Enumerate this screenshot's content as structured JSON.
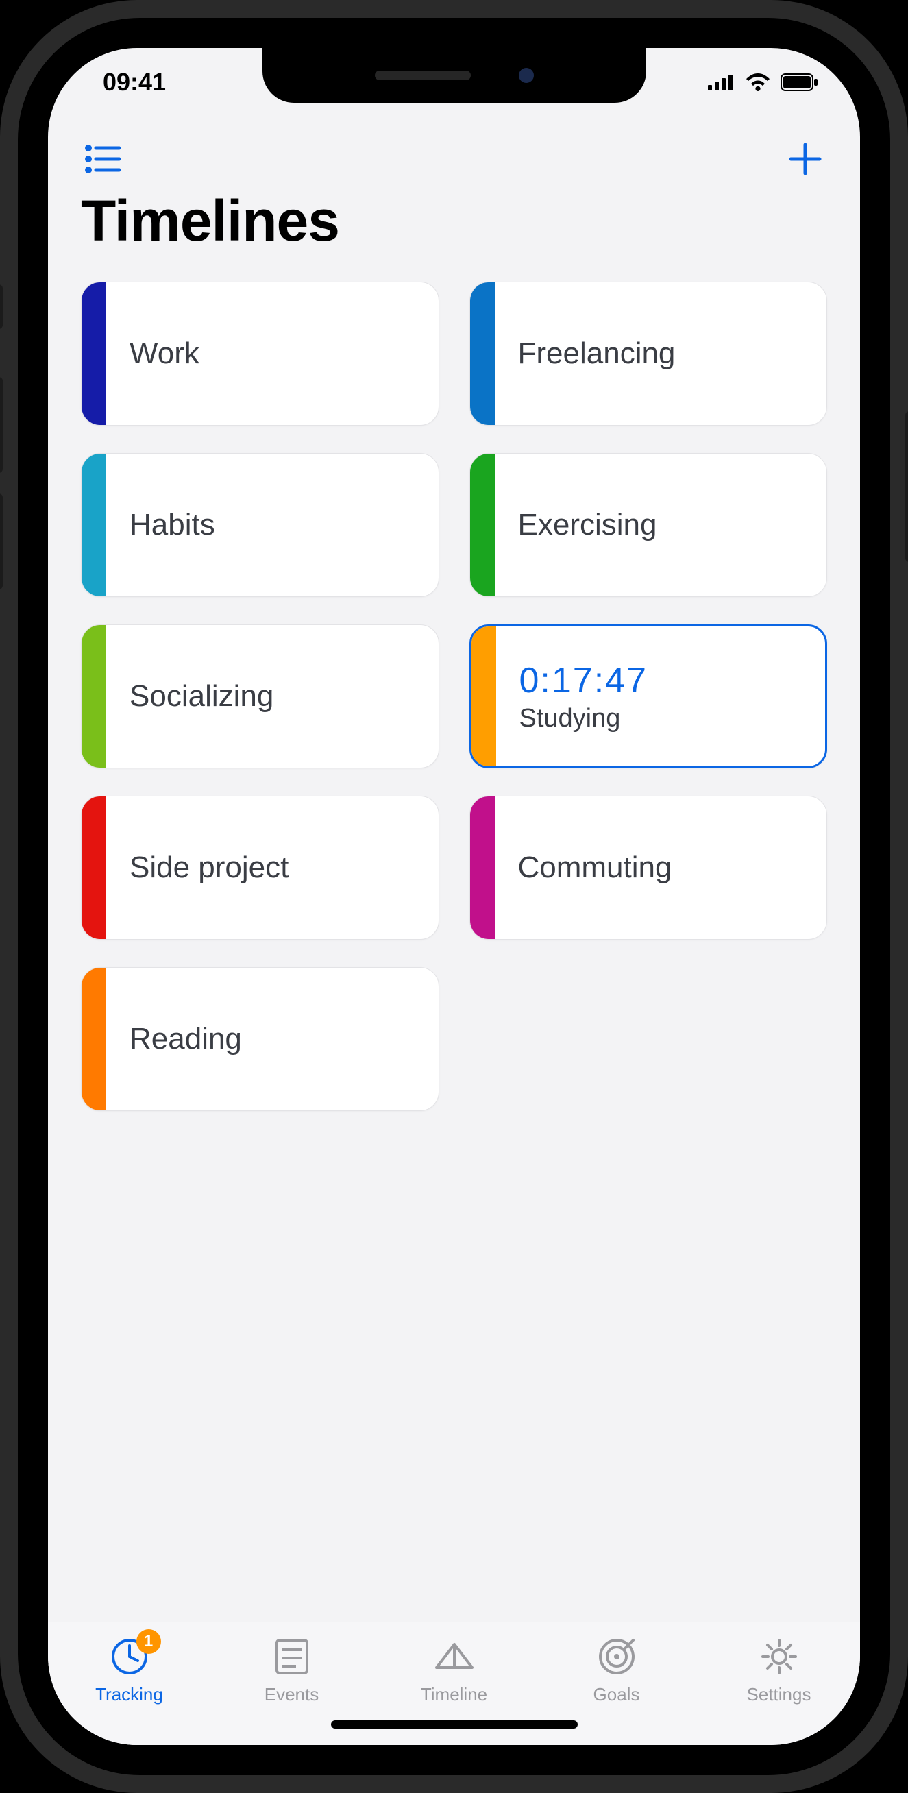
{
  "statusbar": {
    "time": "09:41"
  },
  "page_title": "Timelines",
  "accent_color": "#0b66e4",
  "cards": [
    {
      "label": "Work",
      "color": "#151ca8"
    },
    {
      "label": "Freelancing",
      "color": "#0a73c6"
    },
    {
      "label": "Habits",
      "color": "#19a3c8"
    },
    {
      "label": "Exercising",
      "color": "#1aa51f"
    },
    {
      "label": "Socializing",
      "color": "#7abf1a"
    },
    {
      "label": "Studying",
      "color": "#ff9e00",
      "active": true,
      "timer": "0:17:47"
    },
    {
      "label": "Side project",
      "color": "#e4140f"
    },
    {
      "label": "Commuting",
      "color": "#c1108b"
    },
    {
      "label": "Reading",
      "color": "#ff7a00"
    }
  ],
  "tabs": [
    {
      "label": "Tracking",
      "badge": "1",
      "active": true
    },
    {
      "label": "Events"
    },
    {
      "label": "Timeline"
    },
    {
      "label": "Goals"
    },
    {
      "label": "Settings"
    }
  ]
}
